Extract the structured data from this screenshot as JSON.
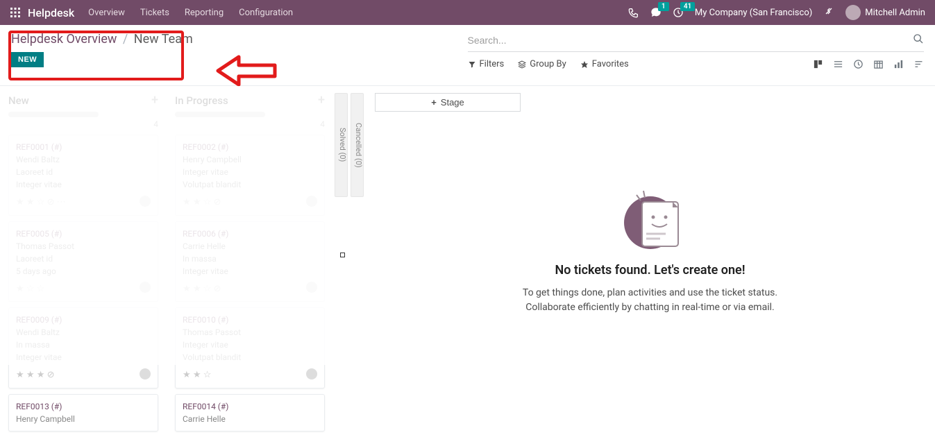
{
  "navbar": {
    "brand": "Helpdesk",
    "items": [
      "Overview",
      "Tickets",
      "Reporting",
      "Configuration"
    ],
    "msg_badge": "1",
    "activity_badge": "41",
    "company": "My Company (San Francisco)",
    "user": "Mitchell Admin"
  },
  "breadcrumb": {
    "link": "Helpdesk Overview",
    "current": "New Team"
  },
  "new_button": "NEW",
  "search": {
    "placeholder": "Search..."
  },
  "filters": {
    "filters": "Filters",
    "groupby": "Group By",
    "favorites": "Favorites"
  },
  "stage_button": "Stage",
  "columns": [
    {
      "title": "New",
      "count": "4",
      "cards": [
        {
          "ref": "REF0001 (#)",
          "name": "Wendi Baltz",
          "l1": "Laoreet id",
          "l2": "Integer vitae"
        },
        {
          "ref": "REF0005 (#)",
          "name": "Thomas Passot",
          "l1": "Laoreet id",
          "l2": "5 days ago"
        },
        {
          "ref": "REF0009 (#)",
          "name": "Wendi Baltz",
          "l1": "In massa",
          "l2": "Integer vitae"
        },
        {
          "ref": "REF0013 (#)",
          "name": "Henry Campbell",
          "l1": "",
          "l2": ""
        }
      ]
    },
    {
      "title": "In Progress",
      "count": "4",
      "cards": [
        {
          "ref": "REF0002 (#)",
          "name": "Henry Campbell",
          "l1": "Integer vitae",
          "l2": "Volutpat blandit"
        },
        {
          "ref": "REF0006 (#)",
          "name": "Carrie Helle",
          "l1": "In massa",
          "l2": "Integer vitae"
        },
        {
          "ref": "REF0010 (#)",
          "name": "Thomas Passot",
          "l1": "Integer vitae",
          "l2": "Volutpat blandit"
        },
        {
          "ref": "REF0014 (#)",
          "name": "Carrie Helle",
          "l1": "",
          "l2": ""
        }
      ]
    }
  ],
  "collapsed": [
    "Solved (0)",
    "Cancelled (0)"
  ],
  "empty": {
    "title": "No tickets found. Let's create one!",
    "line1": "To get things done, plan activities and use the ticket status.",
    "line2": "Collaborate efficiently by chatting in real-time or via email."
  }
}
